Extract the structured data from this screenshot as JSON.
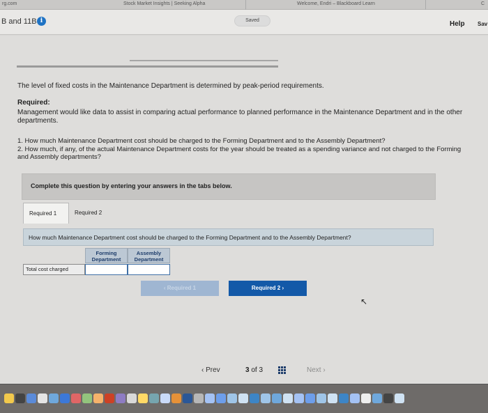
{
  "browser_tabs": [
    {
      "label": "rg.com"
    },
    {
      "label": "Stock Market Insights | Seeking Alpha"
    },
    {
      "label": "Welcome, Endri – Blackboard Learn"
    },
    {
      "label": "C"
    }
  ],
  "header": {
    "title": "B and 11B",
    "info_icon": "i",
    "saved_label": "Saved",
    "help_label": "Help",
    "save_label": "Sav"
  },
  "problem": {
    "intro": "The level of fixed costs in the Maintenance Department is determined by peak-period requirements.",
    "required_heading": "Required:",
    "required_body": "Management would like data to assist in comparing actual performance to planned performance in the Maintenance Department and in the other departments.",
    "question_1": "1. How much Maintenance Department cost should be charged to the Forming Department and to the Assembly Department?",
    "question_2": "2. How much, if any, of the actual Maintenance Department costs for the year should be treated as a spending variance and not charged to the Forming and Assembly departments?",
    "instruction": "Complete this question by entering your answers in the tabs below."
  },
  "tabs": [
    {
      "label": "Required 1",
      "active": true
    },
    {
      "label": "Required 2",
      "active": false
    }
  ],
  "panel": {
    "question": "How much Maintenance Department cost should be charged to the Forming Department and to the Assembly Department?",
    "columns": [
      "Forming Department",
      "Assembly Department"
    ],
    "row_label": "Total cost charged",
    "values": [
      "",
      ""
    ]
  },
  "nav": {
    "prev_required": "‹ Required 1",
    "next_required": "Required 2 ›"
  },
  "pager": {
    "prev": "‹ Prev",
    "current": "3",
    "of_label": "of 3",
    "next": "Next ›"
  },
  "icons": {
    "info": "info-icon",
    "grid": "grid-icon",
    "cursor": "arrow-cursor-icon"
  },
  "colors": {
    "primary_button": "#1359a8",
    "panel_header": "#c9d4db",
    "info_icon": "#1f73c4"
  }
}
